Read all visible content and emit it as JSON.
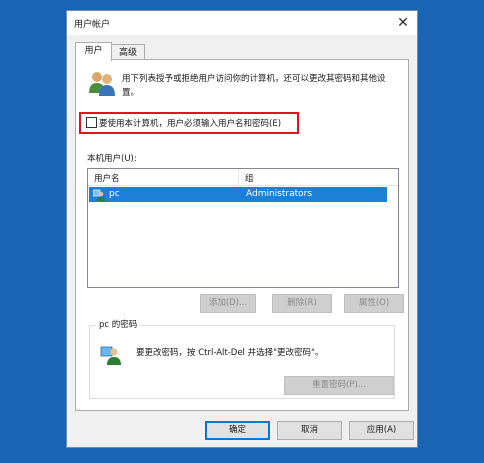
{
  "window": {
    "title": "用户帐户",
    "close_glyph": "✕"
  },
  "tabs": [
    {
      "label": "用户",
      "active": true
    },
    {
      "label": "高级",
      "active": false
    }
  ],
  "intro": {
    "text": "用下列表授予或拒绝用户访问你的计算机，还可以更改其密码和其他设置。",
    "icon": "users-icon"
  },
  "require_login": {
    "label": "要使用本计算机，用户必须输入用户名和密码(E)",
    "checked": false
  },
  "users_section": {
    "label": "本机用户(U):",
    "columns": [
      "用户名",
      "组"
    ],
    "rows": [
      {
        "name": "pc",
        "group": "Administrators",
        "selected": true
      }
    ]
  },
  "user_buttons": {
    "add": "添加(D)...",
    "remove": "删除(R)",
    "properties": "属性(O)"
  },
  "password_section": {
    "title": "pc 的密码",
    "text": "要更改密码，按 Ctrl-Alt-Del 并选择\"更改密码\"。",
    "reset_button": "重置密码(P)..."
  },
  "dialog_buttons": {
    "ok": "确定",
    "cancel": "取消",
    "apply": "应用(A)"
  },
  "colors": {
    "accent": "#0078d7",
    "selection": "#1e7fd6",
    "highlight_box": "#e0141e",
    "desktop": "#1a64b4"
  }
}
